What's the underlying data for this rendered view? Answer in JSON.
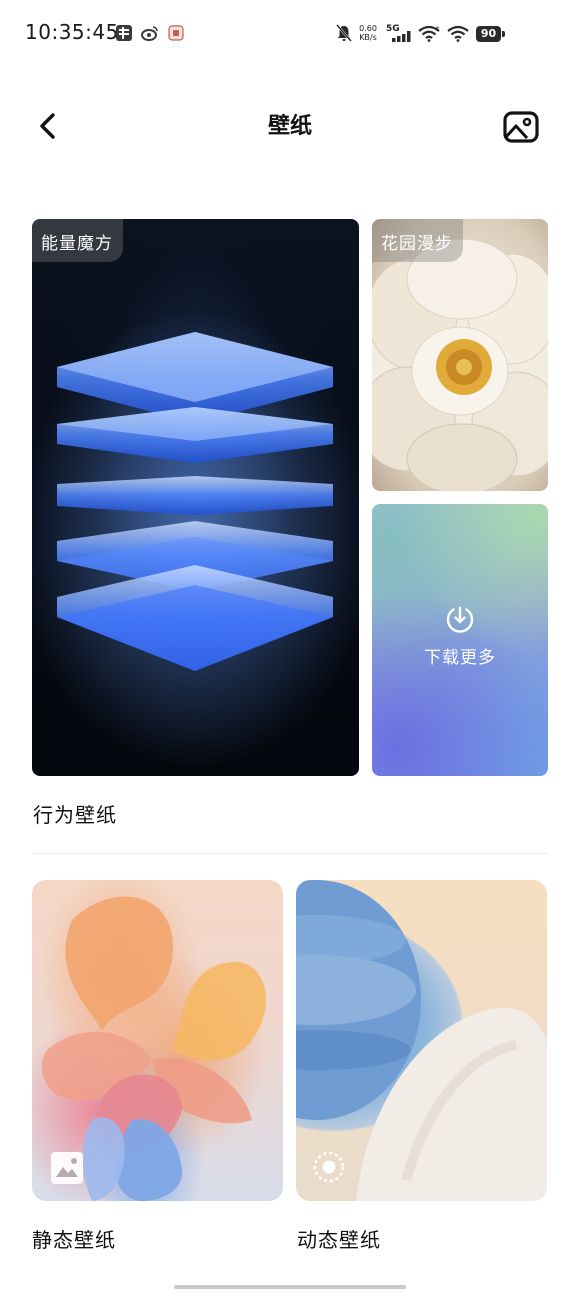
{
  "status_bar": {
    "time": "10:35:45",
    "net_speed_value": "0.60",
    "net_speed_unit": "KB/s",
    "network": "5G",
    "battery": "90"
  },
  "header": {
    "title": "壁纸"
  },
  "wallpapers": {
    "energy_cube": "能量魔方",
    "garden_walk": "花园漫步",
    "download_more": "下载更多"
  },
  "sections": {
    "behavior": "行为壁纸",
    "static": "静态壁纸",
    "dynamic": "动态壁纸"
  }
}
